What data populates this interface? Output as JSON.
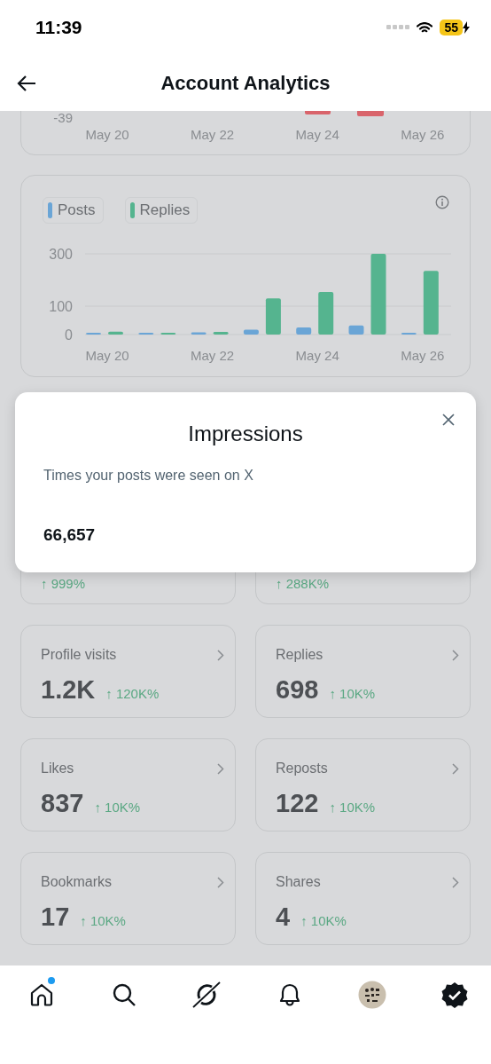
{
  "status_bar": {
    "time": "11:39",
    "battery": "55"
  },
  "header": {
    "title": "Account Analytics"
  },
  "top_chart": {
    "y_tick": "-39",
    "x_labels": [
      "May 20",
      "May 22",
      "May 24",
      "May 26"
    ]
  },
  "activity_chart": {
    "chart_data": {
      "type": "bar",
      "categories": [
        "May 20",
        null,
        "May 22",
        null,
        "May 24",
        null,
        "May 26"
      ],
      "series": [
        {
          "name": "Posts",
          "color": "#6aa5d6",
          "values": [
            1,
            6,
            8,
            17,
            25,
            32,
            1
          ]
        },
        {
          "name": "Replies",
          "color": "#55b48f",
          "values": [
            10,
            1,
            9,
            130,
            154,
            300,
            235
          ]
        }
      ],
      "ylim": [
        0,
        300
      ],
      "yticks": [
        0,
        100,
        300
      ]
    }
  },
  "metrics": [
    {
      "change": "↑ 999%"
    },
    {
      "change": "↑ 288K%"
    },
    {
      "label": "Profile visits",
      "value": "1.2K",
      "change": "↑ 120K%"
    },
    {
      "label": "Replies",
      "value": "698",
      "change": "↑ 10K%"
    },
    {
      "label": "Likes",
      "value": "837",
      "change": "↑ 10K%"
    },
    {
      "label": "Reposts",
      "value": "122",
      "change": "↑ 10K%"
    },
    {
      "label": "Bookmarks",
      "value": "17",
      "change": "↑ 10K%"
    },
    {
      "label": "Shares",
      "value": "4",
      "change": "↑ 10K%"
    }
  ],
  "modal": {
    "title": "Impressions",
    "description": "Times your posts were seen on X",
    "value": "66,657"
  },
  "tab_bar": {
    "items": [
      {
        "kind": "home",
        "unread": true
      },
      {
        "kind": "search",
        "unread": false
      },
      {
        "kind": "grok",
        "unread": false
      },
      {
        "kind": "notifications",
        "unread": false
      },
      {
        "kind": "profile",
        "unread": false
      },
      {
        "kind": "verified",
        "unread": false
      }
    ]
  }
}
